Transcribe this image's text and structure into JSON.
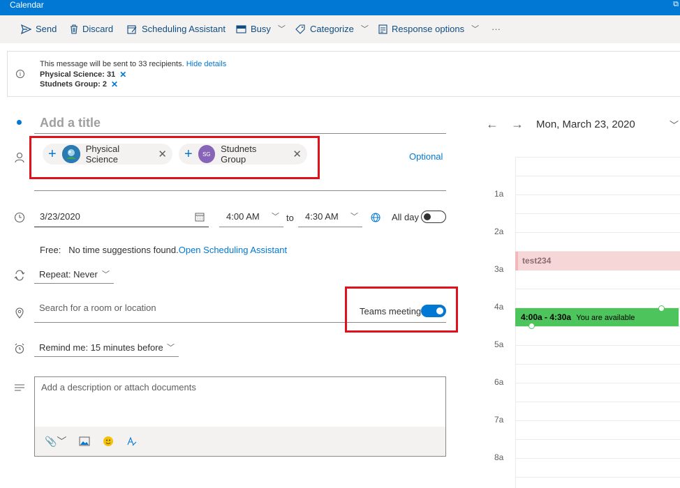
{
  "app": {
    "title": "Calendar"
  },
  "toolbar": {
    "send": "Send",
    "discard": "Discard",
    "scheduling": "Scheduling Assistant",
    "busy": "Busy",
    "categorize": "Categorize",
    "response": "Response options",
    "more": "···"
  },
  "info": {
    "message": "This message will be sent to 33 recipients.",
    "hide": "Hide details",
    "group1": "Physical Science: 31",
    "group2": "Studnets Group: 2"
  },
  "form": {
    "title_placeholder": "Add a title",
    "attendees": [
      {
        "name": "Physical Science",
        "initials": ""
      },
      {
        "name": "Studnets Group",
        "initials": "SG"
      }
    ],
    "optional": "Optional",
    "date": "3/23/2020",
    "start_time": "4:00 AM",
    "to": "to",
    "end_time": "4:30 AM",
    "all_day": "All day",
    "free_label": "Free:",
    "free_text": "No time suggestions found.",
    "free_link": "Open Scheduling Assistant",
    "repeat": "Repeat:",
    "repeat_value": "Never",
    "location_placeholder": "Search for a room or location",
    "teams": "Teams meeting",
    "remind": "Remind me:",
    "remind_value": "15 minutes before",
    "desc_placeholder": "Add a description or attach documents"
  },
  "calendar": {
    "date": "Mon, March 23, 2020",
    "hours": [
      "1a",
      "2a",
      "3a",
      "4a",
      "5a",
      "6a",
      "7a",
      "8a"
    ],
    "event1": "test234",
    "event2_time": "4:00a - 4:30a",
    "event2_status": "You are available"
  },
  "colors": {
    "accent": "#0078d4",
    "highlight_box": "#e0111b",
    "available": "#4ec45c",
    "busy_event": "#f7d6d8"
  }
}
